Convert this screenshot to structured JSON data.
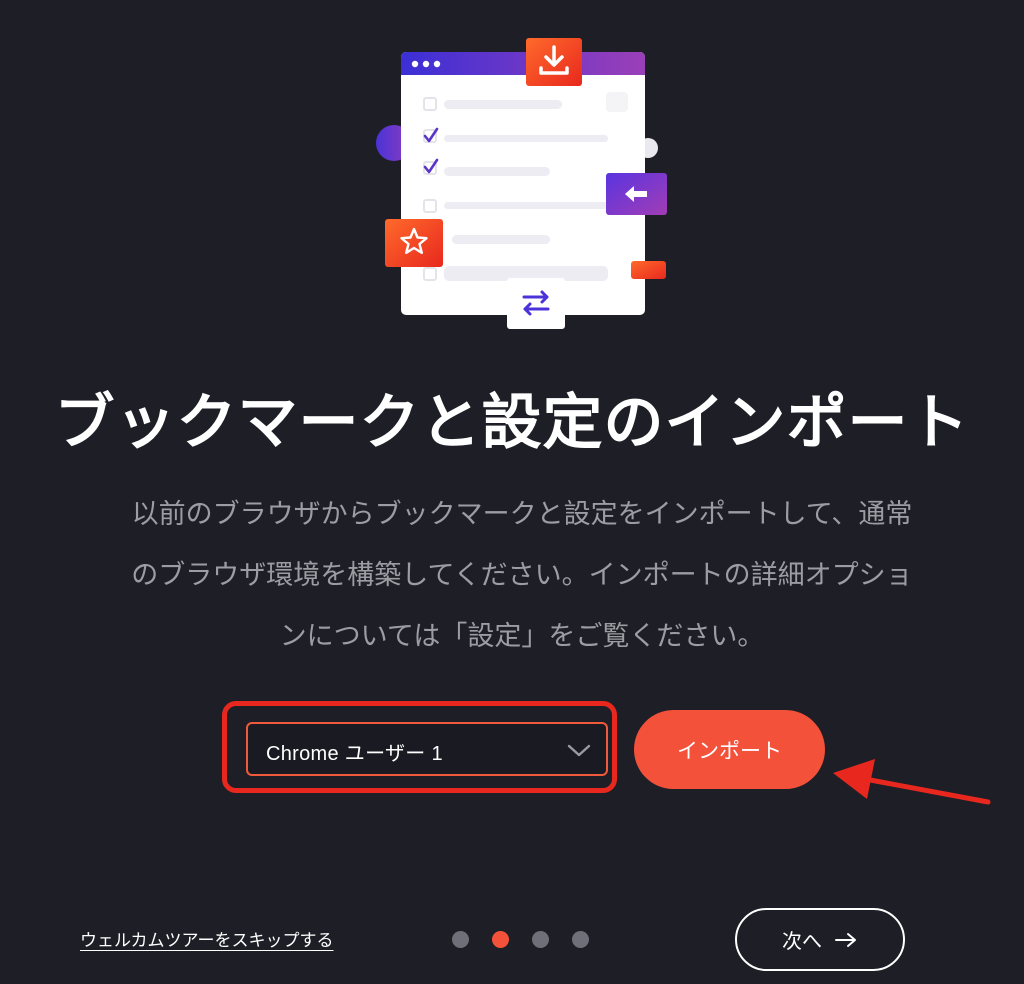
{
  "heading": {
    "title": "ブックマークと設定のインポート"
  },
  "description": {
    "lines": [
      "以前のブラウザからブックマークと設定をインポートして、通常",
      "のブラウザ環境を構築してください。インポートの詳細オプショ",
      "ンについては「設定」をご覧ください。"
    ]
  },
  "import_form": {
    "selected_profile": "Chrome ユーザー 1",
    "dropdown_icon": "chevron-down-icon",
    "import_label": "インポート"
  },
  "footer": {
    "skip_label": "ウェルカムツアーをスキップする",
    "steps_total": 4,
    "steps_current": 2,
    "next_label": "次へ",
    "next_icon": "arrow-right-icon"
  },
  "colors": {
    "background": "#1e1f26",
    "accent": "#f4513a",
    "annotation": "#e8281e",
    "text_muted": "#9c9ca3",
    "dot_inactive": "#6e6f78"
  }
}
